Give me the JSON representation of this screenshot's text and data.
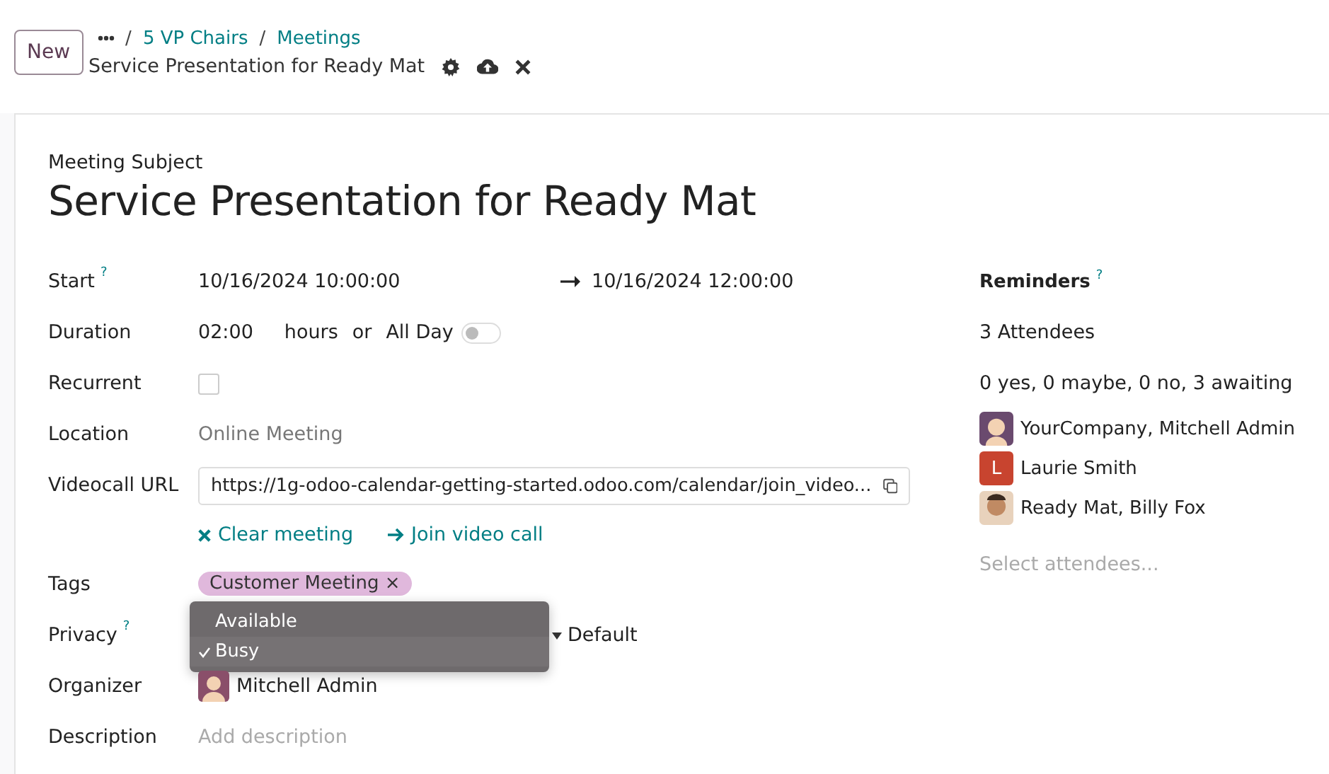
{
  "header": {
    "new_button": "New",
    "separator": "/",
    "breadcrumbs": [
      "5 VP Chairs",
      "Meetings"
    ],
    "record_title": "Service Presentation for Ready Mat"
  },
  "subject": {
    "label": "Meeting Subject",
    "value": "Service Presentation for Ready Mat"
  },
  "start": {
    "label": "Start",
    "help": "?",
    "from": "10/16/2024 10:00:00",
    "to": "10/16/2024 12:00:00"
  },
  "duration": {
    "label": "Duration",
    "value": "02:00",
    "unit": "hours",
    "or": "or",
    "all_day_label": "All Day",
    "all_day": false
  },
  "recurrent": {
    "label": "Recurrent",
    "checked": false
  },
  "location": {
    "label": "Location",
    "placeholder": "Online Meeting"
  },
  "videocall": {
    "label": "Videocall URL",
    "value": "https://1g-odoo-calendar-getting-started.odoo.com/calendar/join_video...",
    "actions": [
      {
        "kind": "clear",
        "label": "Clear meeting"
      },
      {
        "kind": "join",
        "label": "Join video call"
      }
    ]
  },
  "tags": {
    "label": "Tags",
    "items": [
      {
        "label": "Customer Meeting",
        "color": "#e0b8dc",
        "remove": "×"
      }
    ]
  },
  "privacy": {
    "label": "Privacy",
    "help": "?",
    "value": "Default"
  },
  "show_as_menu": [
    {
      "label": "Available",
      "selected": false
    },
    {
      "label": "Busy",
      "selected": true
    }
  ],
  "organizer": {
    "label": "Organizer",
    "name": "Mitchell Admin"
  },
  "description": {
    "label": "Description",
    "placeholder": "Add description"
  },
  "reminders": {
    "label": "Reminders",
    "help": "?"
  },
  "attendees": {
    "count": "3 Attendees",
    "summary": "0 yes, 0 maybe, 0 no, 3 awaiting",
    "people": [
      {
        "name": "YourCompany, Mitchell Admin",
        "kind": "avatar"
      },
      {
        "name": "Laurie Smith",
        "kind": "initial",
        "initial": "L",
        "color": "#c8442f"
      },
      {
        "name": "Ready Mat, Billy Fox"
      }
    ],
    "placeholder": "Select attendees..."
  }
}
